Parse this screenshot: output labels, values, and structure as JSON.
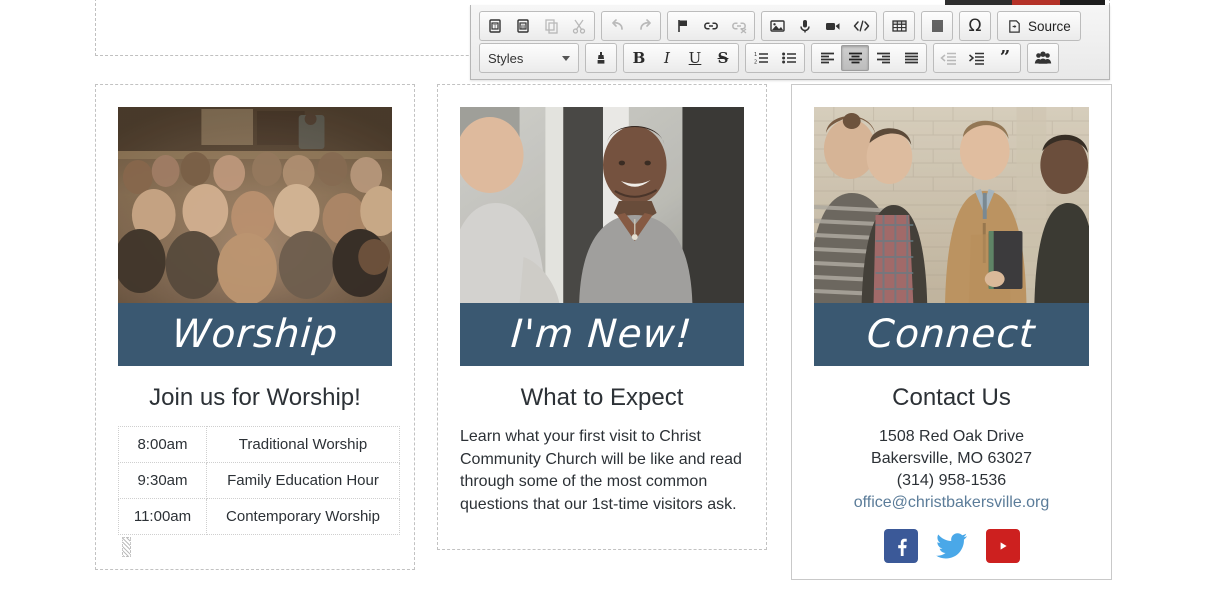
{
  "editor": {
    "toolbar": {
      "row1": [
        {
          "group": 1,
          "name": "paste-text-icon",
          "title": "Paste as plain text",
          "enabled": true
        },
        {
          "group": 1,
          "name": "paste-word-icon",
          "title": "Paste from Word",
          "enabled": true
        },
        {
          "group": 1,
          "name": "copy-icon",
          "title": "Copy",
          "enabled": false
        },
        {
          "group": 1,
          "name": "cut-icon",
          "title": "Cut",
          "enabled": false
        },
        {
          "group": 2,
          "name": "undo-icon",
          "title": "Undo",
          "enabled": false
        },
        {
          "group": 2,
          "name": "redo-icon",
          "title": "Redo",
          "enabled": false
        },
        {
          "group": 3,
          "name": "anchor-flag-icon",
          "title": "Anchor",
          "enabled": true
        },
        {
          "group": 3,
          "name": "link-icon",
          "title": "Link",
          "enabled": true
        },
        {
          "group": 3,
          "name": "unlink-icon",
          "title": "Unlink",
          "enabled": false
        },
        {
          "group": 4,
          "name": "image-icon",
          "title": "Image",
          "enabled": true
        },
        {
          "group": 4,
          "name": "audio-icon",
          "title": "Audio",
          "enabled": true
        },
        {
          "group": 4,
          "name": "video-icon",
          "title": "Video",
          "enabled": true
        },
        {
          "group": 4,
          "name": "embed-code-icon",
          "title": "Embed code",
          "enabled": true
        },
        {
          "group": 5,
          "name": "table-icon",
          "title": "Table",
          "enabled": true
        },
        {
          "group": 6,
          "name": "page-break-icon",
          "title": "Page break",
          "enabled": true
        },
        {
          "group": 7,
          "name": "special-char-icon",
          "title": "Special character",
          "enabled": true
        }
      ],
      "source_label": "Source",
      "styles_label": "Styles",
      "row2": [
        {
          "group": 1,
          "name": "remove-format-icon",
          "title": "Remove format",
          "enabled": true,
          "active": false
        },
        {
          "group": 2,
          "name": "bold-icon",
          "title": "Bold",
          "enabled": true,
          "active": false,
          "glyph": "B"
        },
        {
          "group": 2,
          "name": "italic-icon",
          "title": "Italic",
          "enabled": true,
          "active": false,
          "glyph": "I"
        },
        {
          "group": 2,
          "name": "underline-icon",
          "title": "Underline",
          "enabled": true,
          "active": false,
          "glyph": "U"
        },
        {
          "group": 2,
          "name": "strikethrough-icon",
          "title": "Strikethrough",
          "enabled": true,
          "active": false,
          "glyph": "S"
        },
        {
          "group": 3,
          "name": "numbered-list-icon",
          "title": "Numbered list",
          "enabled": true,
          "active": false
        },
        {
          "group": 3,
          "name": "bulleted-list-icon",
          "title": "Bulleted list",
          "enabled": true,
          "active": false
        },
        {
          "group": 4,
          "name": "align-left-icon",
          "title": "Align left",
          "enabled": true,
          "active": false
        },
        {
          "group": 4,
          "name": "align-center-icon",
          "title": "Align center",
          "enabled": true,
          "active": true
        },
        {
          "group": 4,
          "name": "align-right-icon",
          "title": "Align right",
          "enabled": true,
          "active": false
        },
        {
          "group": 4,
          "name": "align-justify-icon",
          "title": "Justify",
          "enabled": true,
          "active": false
        },
        {
          "group": 5,
          "name": "outdent-icon",
          "title": "Decrease indent",
          "enabled": false,
          "active": false
        },
        {
          "group": 5,
          "name": "indent-icon",
          "title": "Increase indent",
          "enabled": true,
          "active": false
        },
        {
          "group": 5,
          "name": "blockquote-icon",
          "title": "Block quote",
          "enabled": true,
          "active": false
        },
        {
          "group": 6,
          "name": "group-people-icon",
          "title": "Insert people",
          "enabled": true,
          "active": false
        }
      ]
    }
  },
  "banner_color": "#3a5871",
  "columns": [
    {
      "id": "worship",
      "selected": false,
      "photo_alt": "congregation-seated-in-worship-service",
      "banner_text": "Worship",
      "title": "Join us for Worship!",
      "table": {
        "rows": [
          {
            "time": "8:00am",
            "event": "Traditional Worship"
          },
          {
            "time": "9:30am",
            "event": "Family Education Hour"
          },
          {
            "time": "11:00am",
            "event": "Contemporary Worship"
          }
        ]
      }
    },
    {
      "id": "im-new",
      "selected": false,
      "photo_alt": "man-greeting-visitor-with-handshake",
      "banner_text": "I'm New!",
      "title": "What to Expect",
      "body": "Learn what your first visit to Christ Community Church will be like and read through some of the most common questions that our 1st-time visitors ask."
    },
    {
      "id": "connect",
      "selected": true,
      "photo_alt": "group-of-men-talking-outside-brick-building",
      "banner_text": "Connect",
      "title": "Contact Us",
      "address_line_1": "1508 Red Oak Drive",
      "address_line_2": "Bakersville, MO 63027",
      "phone": "(314) 958-1536",
      "email": "office@christbakersville.org",
      "email_color": "#5b7c99",
      "socials": [
        {
          "name": "facebook-icon",
          "label": "Facebook",
          "color": "#3b5998"
        },
        {
          "name": "twitter-icon",
          "label": "Twitter",
          "color": "#4aa8e8"
        },
        {
          "name": "youtube-icon",
          "label": "YouTube",
          "color": "#cd201f"
        }
      ]
    }
  ]
}
